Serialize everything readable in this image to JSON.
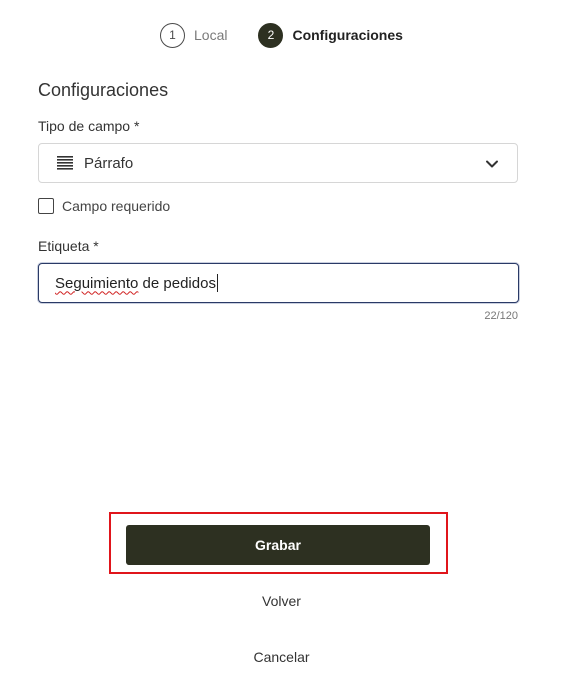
{
  "stepper": {
    "steps": [
      {
        "number": "1",
        "label": "Local",
        "state": "inactive"
      },
      {
        "number": "2",
        "label": "Configuraciones",
        "state": "active"
      }
    ]
  },
  "form": {
    "section_title": "Configuraciones",
    "field_type": {
      "label": "Tipo de campo *",
      "selected_value": "Párrafo",
      "icon": "paragraph-icon"
    },
    "required_checkbox": {
      "label": "Campo requerido",
      "checked": false
    },
    "tag_field": {
      "label": "Etiqueta *",
      "value_misspelled_word": "Seguimiento",
      "value_rest": " de pedidos",
      "counter": "22/120"
    }
  },
  "actions": {
    "save_label": "Grabar",
    "back_label": "Volver",
    "cancel_label": "Cancelar"
  },
  "colors": {
    "primary": "#2d3021",
    "highlight_border": "#e0151b",
    "input_focus_border": "#2a3a66"
  }
}
